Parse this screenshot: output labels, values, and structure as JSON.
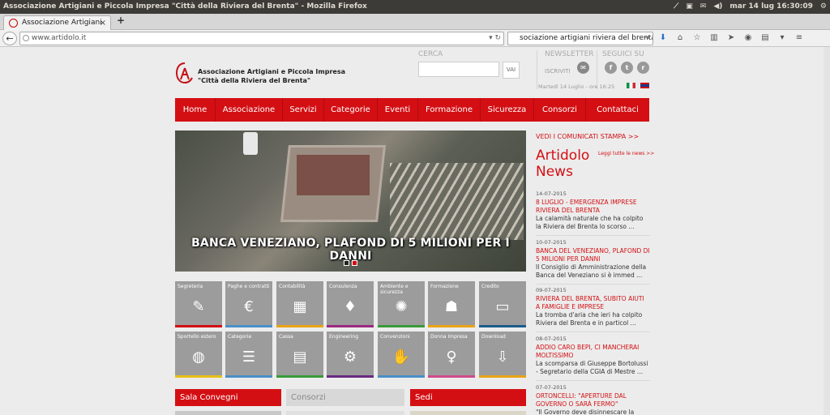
{
  "window": {
    "title": "Associazione Artigiani e Piccola Impresa \"Città della Riviera del Brenta\" - Mozilla Firefox",
    "clock": "mar 14 lug 16:30:09"
  },
  "browser": {
    "tab_title": "Associazione Artigiani ...",
    "tab_close": "×",
    "new_tab": "+",
    "url": "www.artidolo.it",
    "search_value": "sociazione artigiani riviera del brenta",
    "icons": [
      "download-icon",
      "home-icon",
      "bookmark-star-icon",
      "library-icon",
      "send-icon",
      "chat-icon",
      "clipboard-icon",
      "sidebar-icon",
      "menu-icon"
    ]
  },
  "header": {
    "logo_line1": "Associazione Artigiani e Piccola Impresa",
    "logo_line2": "\"Città della Riviera del Brenta\"",
    "search_label": "CERCA",
    "search_button": "VAI",
    "newsletter_label": "NEWSLETTER",
    "subscribe_label": "ISCRIVITI",
    "social_label": "SEGUICI SU",
    "date_text": "Martedì 14 Luglio  - ore 16:25",
    "social": [
      "f",
      "t",
      "r"
    ]
  },
  "menu": [
    "Home",
    "Associazione",
    "Servizi",
    "Categorie",
    "Eventi",
    "Formazione",
    "Sicurezza",
    "Consorzi",
    "Contattaci"
  ],
  "slider": {
    "caption": "BANCA VENEZIANO, PLAFOND DI 5 MILIONI PER I DANNI",
    "active_dot": 1,
    "dot_count": 2
  },
  "tiles": [
    {
      "label": "Segreteria",
      "icon": "✎",
      "color": "#d30f13"
    },
    {
      "label": "Paghe e contratti",
      "icon": "€",
      "color": "#4a90c8"
    },
    {
      "label": "Contabilità",
      "icon": "▦",
      "color": "#e8a317"
    },
    {
      "label": "Consulenza",
      "icon": "♦",
      "color": "#9b2a7f"
    },
    {
      "label": "Ambiente e sicurezza",
      "icon": "✺",
      "color": "#3a9a3a"
    },
    {
      "label": "Formazione",
      "icon": "☗",
      "color": "#e8a317"
    },
    {
      "label": "Credito",
      "icon": "▭",
      "color": "#1a5c8a"
    },
    {
      "label": "Sportello estero",
      "icon": "◍",
      "color": "#e8c017"
    },
    {
      "label": "Categorie",
      "icon": "☰",
      "color": "#4a90c8"
    },
    {
      "label": "Cassa",
      "icon": "▤",
      "color": "#3a9a3a"
    },
    {
      "label": "Engineering",
      "icon": "⚙",
      "color": "#6a2a7f"
    },
    {
      "label": "Convenzioni",
      "icon": "✋",
      "color": "#4a90c8"
    },
    {
      "label": "Donna Impresa",
      "icon": "♀",
      "color": "#d04a8a"
    },
    {
      "label": "Download",
      "icon": "⇩",
      "color": "#e8a317"
    }
  ],
  "sections": {
    "sala": "Sala Convegni",
    "consorzi": "Consorzi",
    "sedi": "Sedi"
  },
  "news": {
    "press_link": "VEDI I COMUNICATI STAMPA >>",
    "title_line1": "Artidolo",
    "title_line2": "News",
    "all_link": "Leggi tutte le news >>",
    "items": [
      {
        "date": "14-07-2015",
        "headline": "8 LUGLIO - EMERGENZA IMPRESE RIVIERA DEL BRENTA",
        "text": "La calamità naturale che ha colpito la Riviera del Brenta lo scorso ..."
      },
      {
        "date": "10-07-2015",
        "headline": "BANCA DEL VENEZIANO, PLAFOND DI 5 MILIONI PER DANNI",
        "text": "Il Consiglio di Amministrazione della Banca del Veneziano si è immed ..."
      },
      {
        "date": "09-07-2015",
        "headline": "RIVIERA DEL BRENTA, SUBITO AIUTI A FAMIGLIE E IMPRESE",
        "text": "La tromba d'aria che ieri ha colpito Riviera del Brenta e in particol ..."
      },
      {
        "date": "08-07-2015",
        "headline": "ADDIO CARO BEPI, CI MANCHERAI MOLTISSIMO",
        "text": "La scomparsa di Giuseppe Bortolussi - Segretario della CGIA di Mestre ..."
      },
      {
        "date": "07-07-2015",
        "headline": "ORTONCELLI: \"APERTURE DAL GOVERNO O SARÀ FERMO\"",
        "text": "\"Il Governo deve disinnescare la"
      }
    ]
  }
}
